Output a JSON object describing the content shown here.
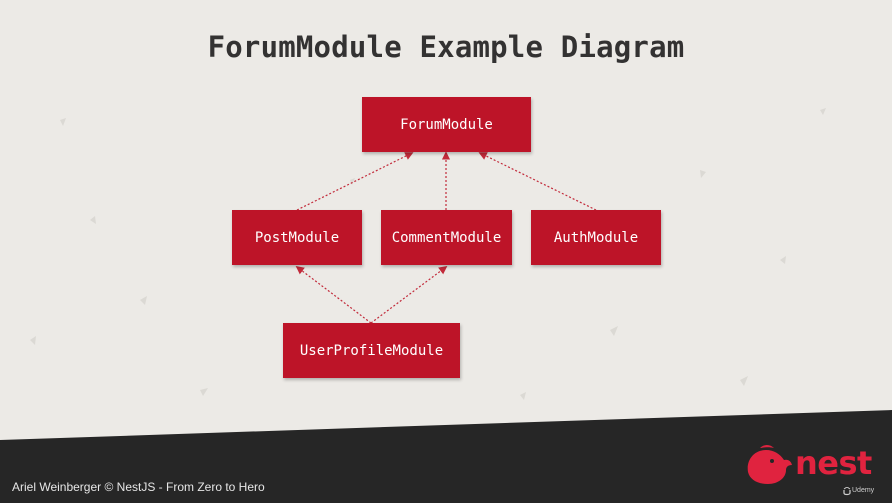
{
  "slide": {
    "title": "ForumModule Example Diagram"
  },
  "diagram": {
    "nodes": {
      "forum": "ForumModule",
      "post": "PostModule",
      "comment": "CommentModule",
      "auth": "AuthModule",
      "user_profile": "UserProfileModule"
    },
    "edges": [
      {
        "from": "PostModule",
        "to": "ForumModule"
      },
      {
        "from": "CommentModule",
        "to": "ForumModule"
      },
      {
        "from": "AuthModule",
        "to": "ForumModule"
      },
      {
        "from": "UserProfileModule",
        "to": "PostModule"
      },
      {
        "from": "UserProfileModule",
        "to": "CommentModule"
      }
    ],
    "colors": {
      "node_fill": "#bd1428",
      "node_text": "#ffffff",
      "edge": "#c22a3a"
    }
  },
  "footer": {
    "credit": "Ariel Weinberger © NestJS - From Zero to Hero",
    "brand": "nest",
    "platform": "Udemy",
    "brand_color": "#e0233f"
  }
}
